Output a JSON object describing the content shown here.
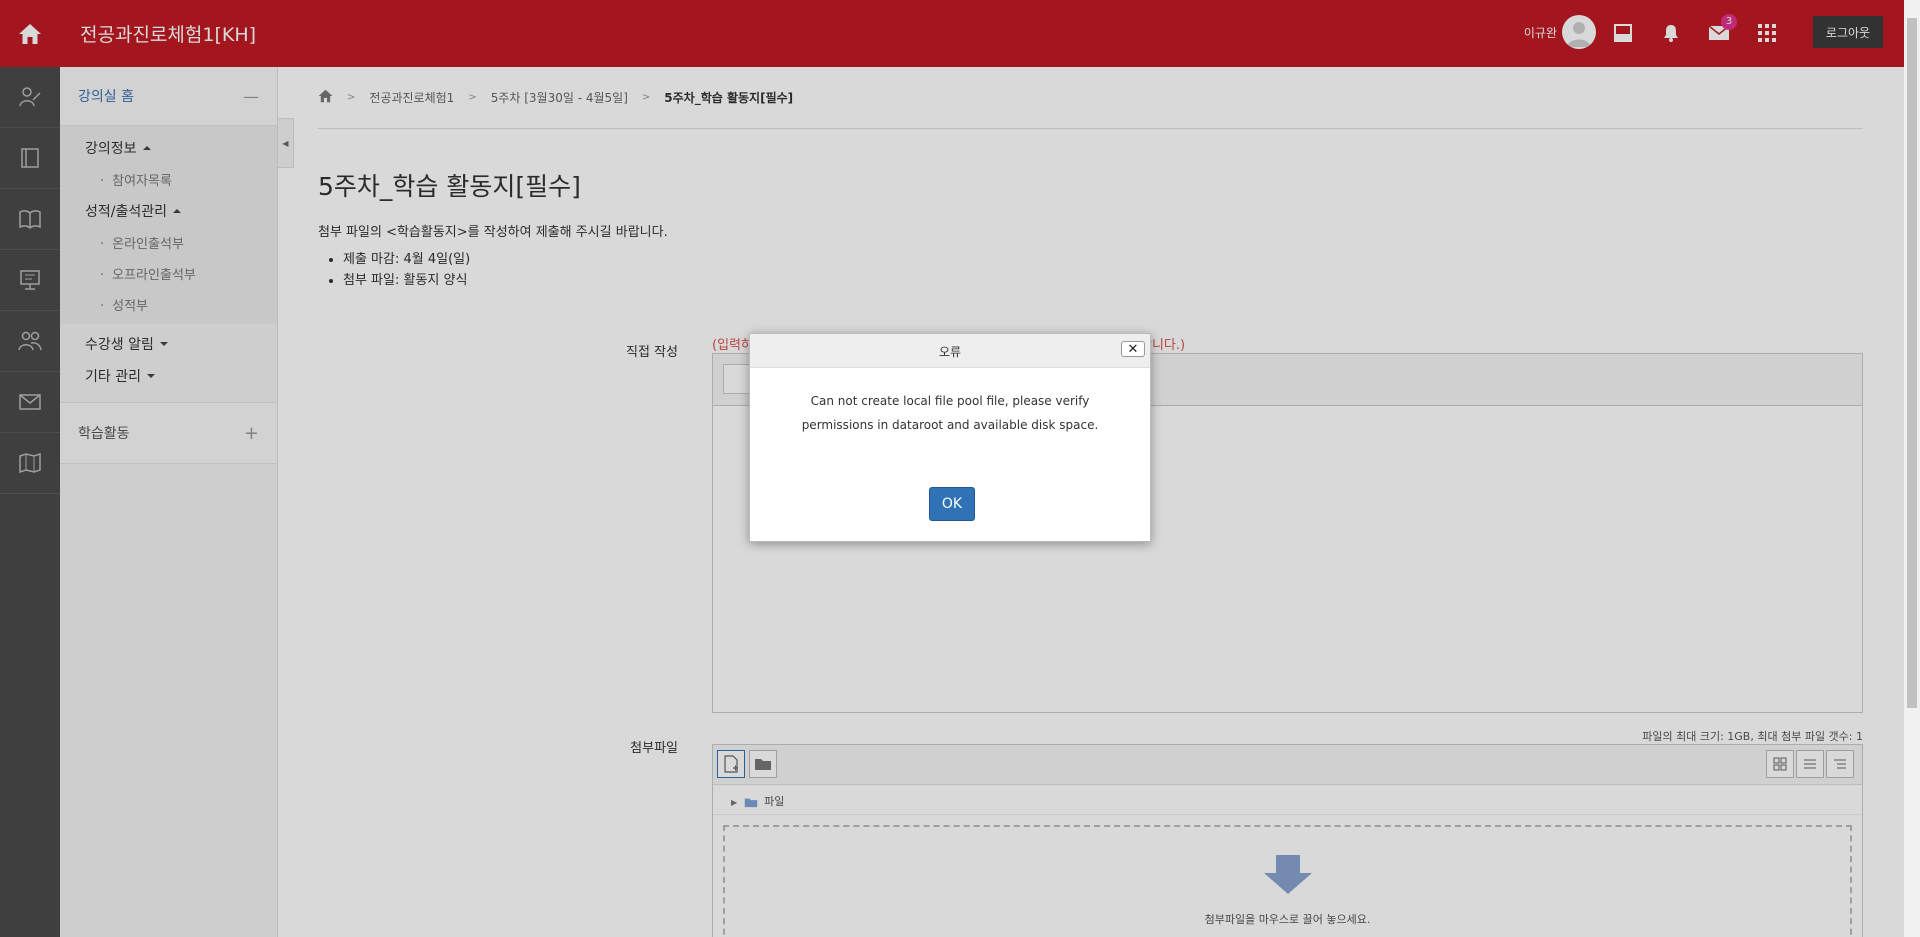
{
  "header": {
    "site_title": "전공과진로체험1[KH]",
    "username": "이규완",
    "notification_count": "3",
    "logout_label": "로그아웃",
    "brand_color": "#c01a24"
  },
  "rail": {
    "icons": [
      "user-edit-icon",
      "notebook-icon",
      "book-icon",
      "presentation-icon",
      "people-icon",
      "mail-icon",
      "map-icon"
    ]
  },
  "sidebar": {
    "home_label": "강의실 홈",
    "sections": [
      {
        "label": "강의정보",
        "items": [
          "참여자목록"
        ]
      },
      {
        "label": "성적/출석관리",
        "items": [
          "온라인출석부",
          "오프라인출석부",
          "성적부"
        ]
      }
    ],
    "extra": [
      "수강생 알림",
      "기타 관리"
    ],
    "activity_label": "학습활동"
  },
  "breadcrumb": [
    "전공과진로체험1",
    "5주차 [3월30일 - 4월5일]",
    "5주차_학습 활동지[필수]"
  ],
  "page": {
    "title": "5주차_학습 활동지[필수]",
    "intro": "첨부 파일의 <학습활동지>를 작성하여 제출해 주시길 바랍니다.",
    "bullets": [
      "제출 마감: 4월 4일(일)",
      "첨부 파일: 활동지 양식"
    ]
  },
  "form": {
    "direct_label": "직접 작성",
    "req_note_start": "(입력하",
    "req_note_end": "합니다.)",
    "attach_label": "첨부파일",
    "file_info": "파일의 최대 크기: 1GB, 최대 첨부 파일 갯수: 1",
    "folder_label": "파일",
    "drop_text": "첨부파일을 마우스로 끌어 놓으세요."
  },
  "dialog": {
    "title": "오류",
    "message": "Can not create local file pool file, please verify permissions in dataroot and available disk space.",
    "ok_label": "OK"
  }
}
